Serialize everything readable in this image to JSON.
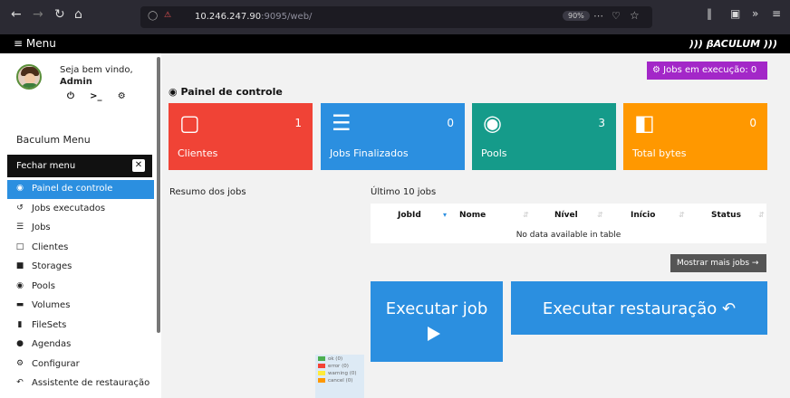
{
  "browser": {
    "url_host": "10.246.247.90",
    "url_rest": ":9095/web/",
    "zoom": "90%"
  },
  "appbar": {
    "menu_label": "Menu",
    "brand": "))) βACULUM )))"
  },
  "sidebar": {
    "welcome": "Seja bem vindo,",
    "username": "Admin",
    "menu_title": "Baculum Menu",
    "close_menu": "Fechar menu",
    "items": [
      {
        "label": "Painel de controle",
        "icon": "dashboard-icon",
        "active": true
      },
      {
        "label": "Jobs executados",
        "icon": "history-icon"
      },
      {
        "label": "Jobs",
        "icon": "list-icon"
      },
      {
        "label": "Clientes",
        "icon": "desktop-icon"
      },
      {
        "label": "Storages",
        "icon": "database-icon"
      },
      {
        "label": "Pools",
        "icon": "pool-icon"
      },
      {
        "label": "Volumes",
        "icon": "hdd-icon"
      },
      {
        "label": "FileSets",
        "icon": "copy-icon"
      },
      {
        "label": "Agendas",
        "icon": "clock-icon"
      },
      {
        "label": "Configurar",
        "icon": "gear-icon"
      },
      {
        "label": "Assistente de restauração",
        "icon": "undo-icon"
      }
    ]
  },
  "main": {
    "jobs_running": "Jobs em execução: 0",
    "panel_title": "Painel de controle",
    "tiles": [
      {
        "label": "Clientes",
        "count": "1",
        "color": "#f04336",
        "icon": "monitor-icon"
      },
      {
        "label": "Jobs Finalizados",
        "count": "0",
        "color": "#2b8fe0",
        "icon": "tasks-icon"
      },
      {
        "label": "Pools",
        "count": "3",
        "color": "#159b8a",
        "icon": "pool-icon"
      },
      {
        "label": "Total bytes",
        "count": "0",
        "color": "#ff9800",
        "icon": "files-icon"
      }
    ],
    "jobs_summary": "Resumo dos jobs",
    "last_jobs": "Último 10 jobs",
    "table": {
      "headers": [
        "JobId",
        "Nome",
        "Nível",
        "Início",
        "Status"
      ],
      "empty": "No data available in table"
    },
    "more_jobs": "Mostrar mais jobs",
    "run_job": "Executar job",
    "run_restore": "Executar restauração",
    "legend": [
      {
        "label": "ok (0)",
        "color": "#4caf50"
      },
      {
        "label": "error (0)",
        "color": "#f44336"
      },
      {
        "label": "warning (0)",
        "color": "#ffeb3b"
      },
      {
        "label": "cancel (0)",
        "color": "#ff9800"
      }
    ]
  }
}
